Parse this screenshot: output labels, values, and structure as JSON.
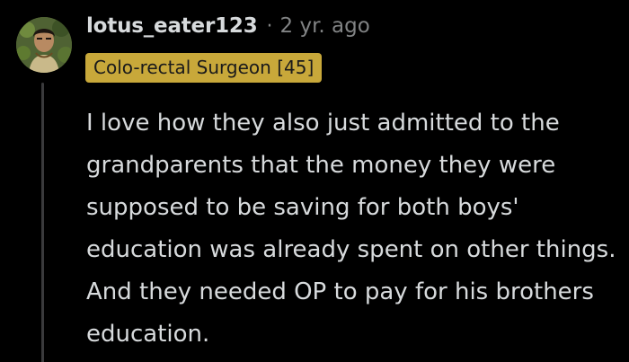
{
  "comment": {
    "avatar_icon": "user-avatar-portrait-icon",
    "username": "lotus_eater123",
    "separator": "·",
    "timestamp": "2 yr. ago",
    "flair": "Colo-rectal Surgeon [45]",
    "body": "I love how they also just admitted to the grandparents that the money they were supposed to be saving for both boys' education was already spent on other things. And they needed OP to pay for his brothers education."
  },
  "colors": {
    "background": "#000000",
    "text": "#d7dadc",
    "muted": "#818384",
    "flair_bg": "#c8a83a",
    "thread_line": "#3a3a3c"
  }
}
